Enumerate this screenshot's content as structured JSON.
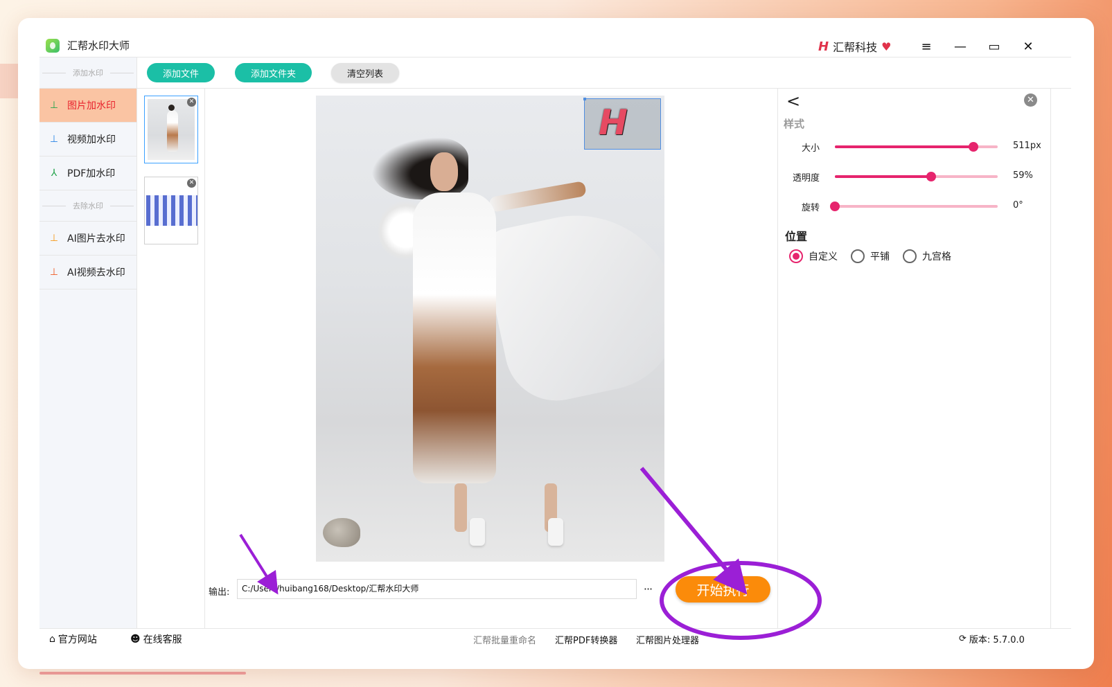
{
  "app": {
    "title": "汇帮水印大师",
    "brand": "汇帮科技"
  },
  "window_controls": {
    "menu": "≡",
    "minimize": "—",
    "maximize": "▭",
    "close": "✕"
  },
  "toolbar": {
    "add_file": "添加文件",
    "add_folder": "添加文件夹",
    "clear_list": "清空列表"
  },
  "sidebar": {
    "section_add": "添加水印",
    "items_add": [
      {
        "label": "图片加水印",
        "icon": "stamp-icon",
        "color": "#e8232d",
        "active": true
      },
      {
        "label": "视频加水印",
        "icon": "stamp-icon",
        "color": "#2a86e6"
      },
      {
        "label": "PDF加水印",
        "icon": "pdf-icon",
        "color": "#22a34a"
      }
    ],
    "section_remove": "去除水印",
    "items_remove": [
      {
        "label": "AI图片去水印",
        "icon": "stamp-icon",
        "color": "#f59a1a"
      },
      {
        "label": "AI视频去水印",
        "icon": "stamp-icon",
        "color": "#f05a24"
      }
    ]
  },
  "output": {
    "label": "输出:",
    "path": "C:/Users/huibang168/Desktop/汇帮水印大师",
    "more": "···"
  },
  "start_button": "开始执行",
  "panel": {
    "style_title": "样式",
    "size": {
      "label": "大小",
      "value": "511px",
      "fraction": 0.85
    },
    "opacity": {
      "label": "透明度",
      "value": "59%",
      "fraction": 0.59
    },
    "rotate": {
      "label": "旋转",
      "value": "0°",
      "fraction": 0.0
    },
    "position_title": "位置",
    "position_options": [
      {
        "label": "自定义",
        "selected": true
      },
      {
        "label": "平铺",
        "selected": false
      },
      {
        "label": "九宫格",
        "selected": false
      }
    ]
  },
  "footer": {
    "website": "官方网站",
    "support": "在线客服",
    "links": [
      "汇帮批量重命名",
      "汇帮PDF转换器",
      "汇帮图片处理器"
    ],
    "version": "版本: 5.7.0.0"
  },
  "colors": {
    "accent": "#e6246d",
    "green": "#1bbfa6",
    "orange": "#fb8b0a",
    "annotation": "#9b1fd6"
  }
}
